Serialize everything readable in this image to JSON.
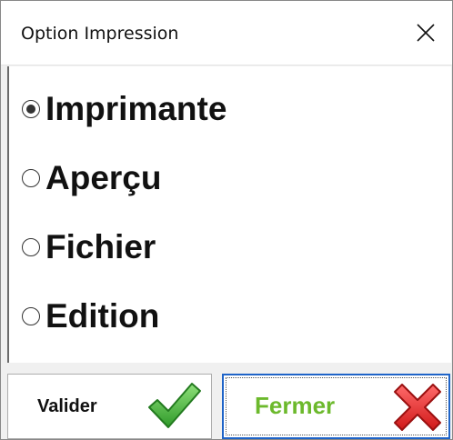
{
  "window": {
    "title": "Option Impression",
    "close_icon": "close-icon"
  },
  "options": {
    "items": [
      {
        "label": "Imprimante",
        "checked": true
      },
      {
        "label": "Aperçu",
        "checked": false
      },
      {
        "label": "Fichier",
        "checked": false
      },
      {
        "label": "Edition",
        "checked": false
      }
    ]
  },
  "buttons": {
    "valider": {
      "label": "Valider",
      "icon": "checkmark-icon"
    },
    "fermer": {
      "label": "Fermer",
      "icon": "red-cross-icon",
      "label_color": "#6cb92c",
      "focus_border_color": "#1f64c8"
    }
  }
}
